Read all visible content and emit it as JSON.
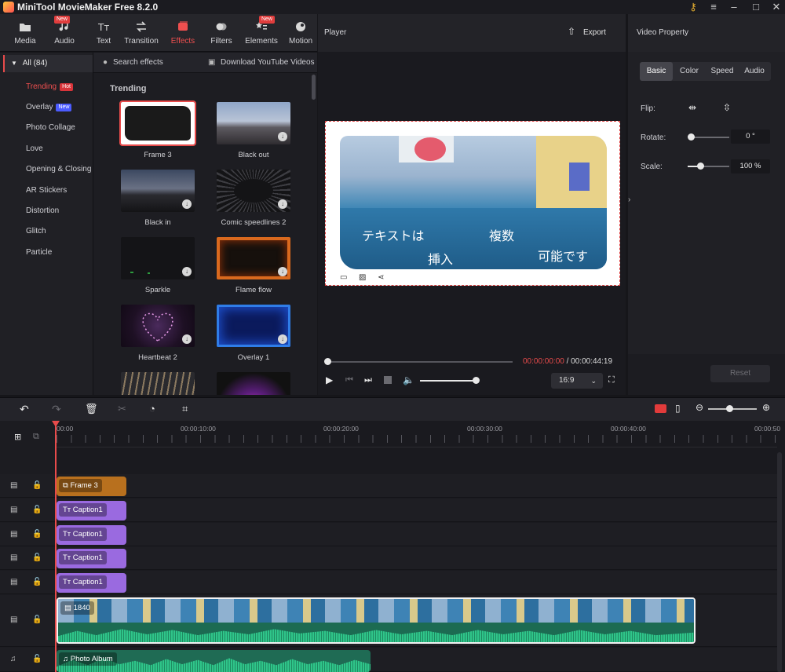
{
  "app": {
    "title": "MiniTool MovieMaker Free 8.2.0"
  },
  "toolbar": {
    "items": [
      {
        "label": "Media"
      },
      {
        "label": "Audio",
        "badge": "New"
      },
      {
        "label": "Text"
      },
      {
        "label": "Transition"
      },
      {
        "label": "Effects",
        "active": true
      },
      {
        "label": "Filters"
      },
      {
        "label": "Elements",
        "badge": "New"
      },
      {
        "label": "Motion"
      }
    ]
  },
  "categories": {
    "all_label": "All (84)",
    "items": [
      {
        "label": "Trending",
        "badge": "Hot",
        "active": true
      },
      {
        "label": "Overlay",
        "badge": "New"
      },
      {
        "label": "Photo Collage"
      },
      {
        "label": "Love"
      },
      {
        "label": "Opening & Closing"
      },
      {
        "label": "AR Stickers"
      },
      {
        "label": "Distortion"
      },
      {
        "label": "Glitch"
      },
      {
        "label": "Particle"
      }
    ]
  },
  "effects": {
    "search_placeholder": "Search effects",
    "download_label": "Download YouTube Videos",
    "section_title": "Trending",
    "items": [
      {
        "label": "Frame 3"
      },
      {
        "label": "Black out"
      },
      {
        "label": "Black in"
      },
      {
        "label": "Comic speedlines 2"
      },
      {
        "label": "Sparkle"
      },
      {
        "label": "Flame flow"
      },
      {
        "label": "Heartbeat 2"
      },
      {
        "label": "Overlay 1"
      }
    ]
  },
  "player": {
    "title": "Player",
    "export_label": "Export",
    "captions": [
      "テキストは",
      "挿入",
      "複数",
      "可能です"
    ],
    "time_current": "00:00:00:00",
    "time_sep": " / ",
    "time_total": "00:00:44:19",
    "aspect": "16:9",
    "volume_level": 0.9
  },
  "property": {
    "title": "Video Property",
    "tabs": [
      "Basic",
      "Color",
      "Speed",
      "Audio"
    ],
    "active_tab": "Basic",
    "flip_label": "Flip:",
    "rotate_label": "Rotate:",
    "rotate_value": "0 °",
    "scale_label": "Scale:",
    "scale_value": "100 %",
    "reset_label": "Reset"
  },
  "timeline": {
    "ticks": [
      "00:00",
      "00:00:10:00",
      "00:00:20:00",
      "00:00:30:00",
      "00:00:40:00",
      "00:00:50"
    ],
    "clips": {
      "frame": "Frame 3",
      "captions": [
        "Caption1",
        "Caption1",
        "Caption1",
        "Caption1"
      ],
      "video": "1840",
      "audio": "Photo Album"
    }
  },
  "colors": {
    "accent": "#e84b4b",
    "frame_clip": "#b8701e",
    "caption_clip": "#9a6ae0",
    "audio_wave": "#2fc58a"
  }
}
